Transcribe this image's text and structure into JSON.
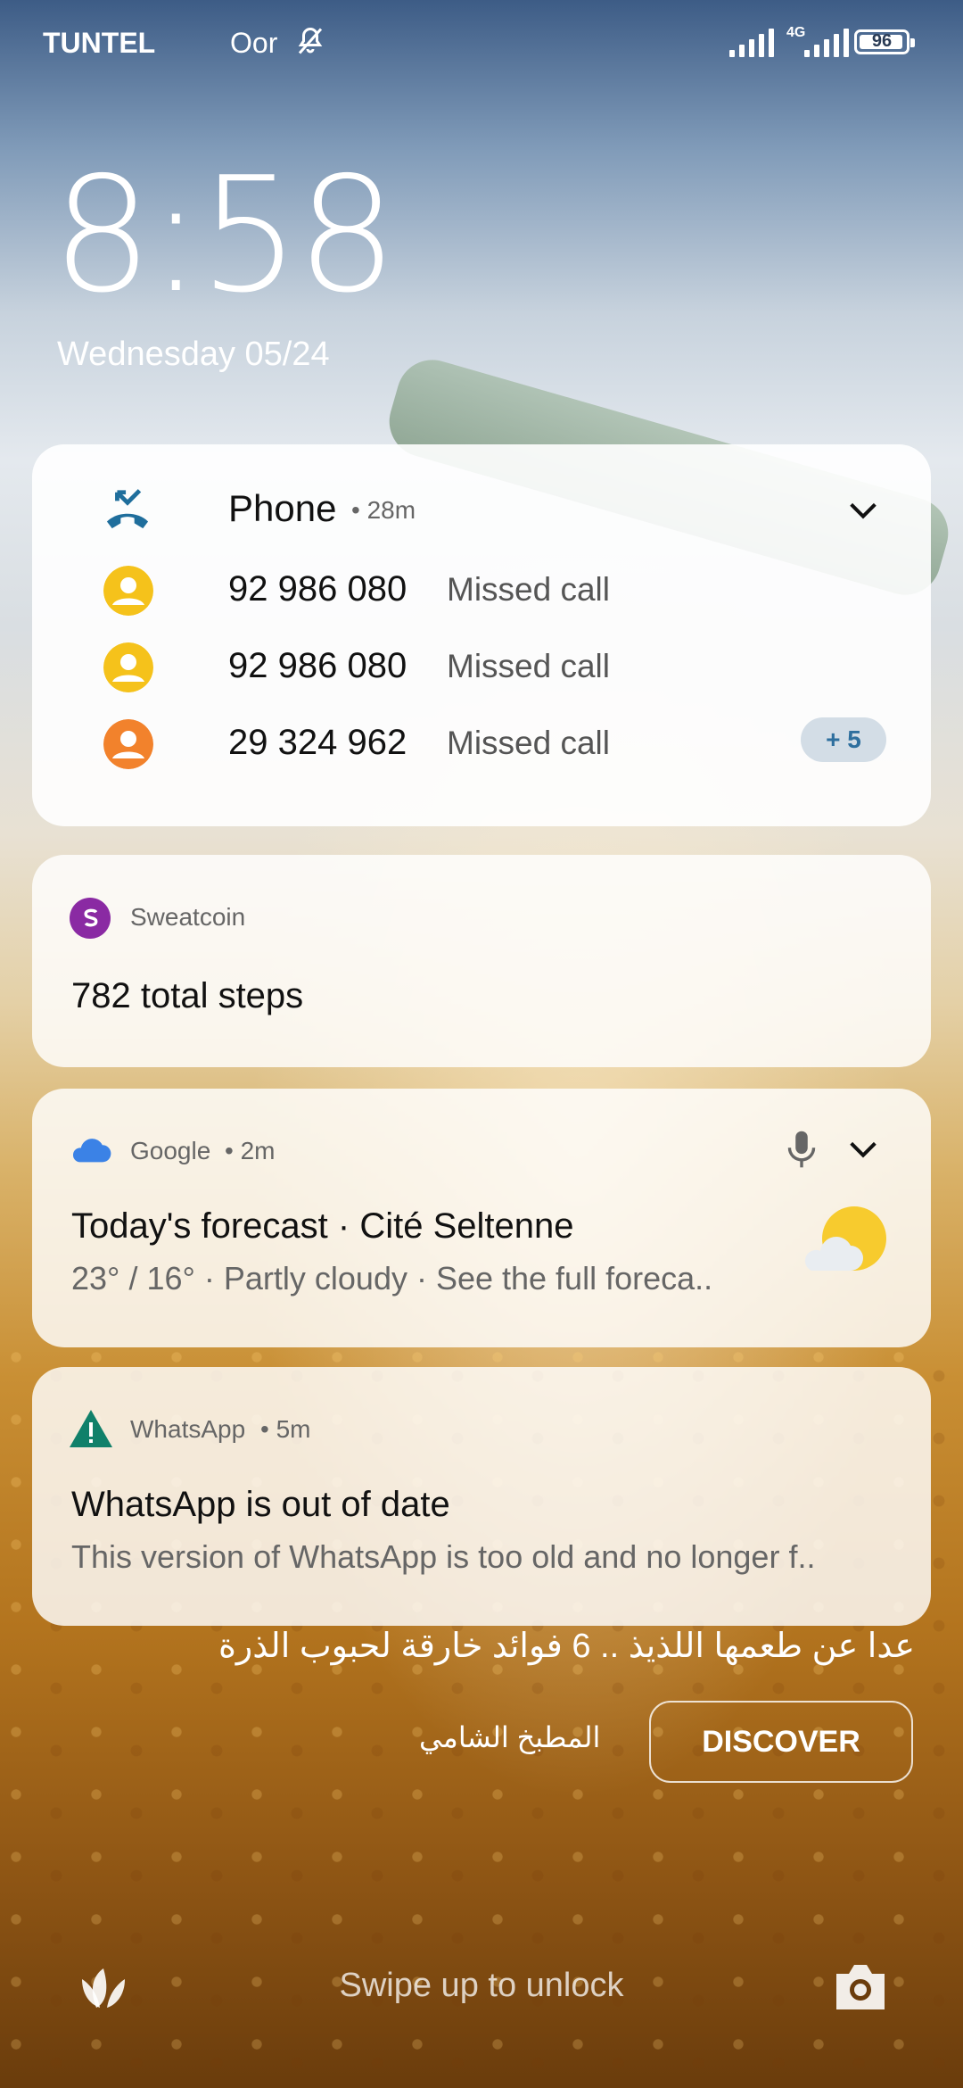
{
  "status_bar": {
    "carrier1": "TUNTEL",
    "carrier2": "Oor",
    "network": "4G",
    "battery": "96"
  },
  "lockscreen": {
    "time": "8:58",
    "date": "Wednesday 05/24"
  },
  "notifications": {
    "phone": {
      "app": "Phone",
      "time": "• 28m",
      "calls": [
        {
          "number": "92 986 080",
          "label": "Missed call",
          "avatar_color": "#f5c21b"
        },
        {
          "number": "92 986 080",
          "label": "Missed call",
          "avatar_color": "#f5c21b"
        },
        {
          "number": "29 324 962",
          "label": "Missed call",
          "avatar_color": "#f2822c"
        }
      ],
      "more": "+ 5"
    },
    "sweatcoin": {
      "app": "Sweatcoin",
      "text": "782 total steps"
    },
    "google": {
      "app": "Google",
      "time": "• 2m",
      "title": "Today's forecast · Cité Seltenne",
      "subtitle": "23° / 16° · Partly cloudy · See the full foreca.."
    },
    "whatsapp": {
      "app": "WhatsApp",
      "time": "• 5m",
      "title": "WhatsApp is out of date",
      "subtitle": "This version of WhatsApp is too old and no longer f.."
    }
  },
  "glance": {
    "headline": "عدا عن طعمها اللذيذ .. 6 فوائد خارقة لحبوب الذرة",
    "source": "المطبخ الشامي",
    "button": "DISCOVER"
  },
  "bottom": {
    "swipe": "Swipe up to unlock"
  },
  "colors": {
    "phone_icon": "#1f6e9c",
    "sweatcoin": "#8a2aa3",
    "google_cloud": "#3b82e6",
    "whatsapp_warning": "#10806a"
  }
}
